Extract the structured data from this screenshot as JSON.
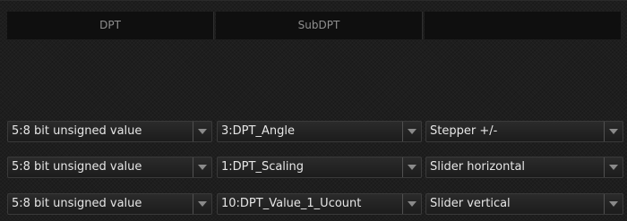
{
  "header": {
    "columns": [
      "DPT",
      "SubDPT",
      ""
    ]
  },
  "rows": [
    {
      "dpt": "5:8 bit unsigned value",
      "subdpt": "3:DPT_Angle",
      "widget": "Stepper +/-"
    },
    {
      "dpt": "5:8 bit unsigned value",
      "subdpt": "1:DPT_Scaling",
      "widget": "Slider horizontal"
    },
    {
      "dpt": "5:8 bit unsigned value",
      "subdpt": "10:DPT_Value_1_Ucount",
      "widget": "Slider vertical"
    }
  ],
  "icons": {
    "dropdown": "chevron-down-icon"
  }
}
